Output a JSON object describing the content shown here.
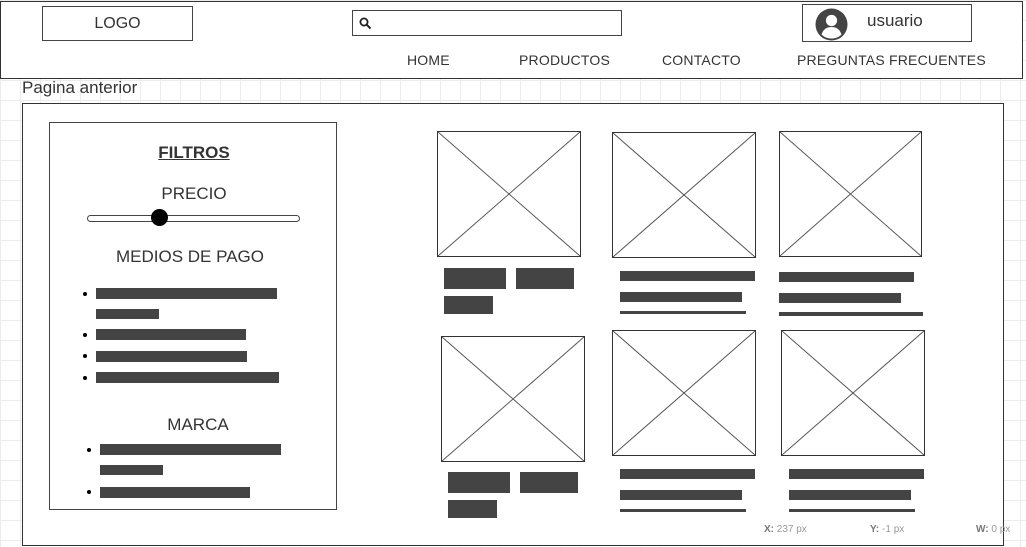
{
  "header": {
    "logo_label": "LOGO",
    "search_placeholder": "",
    "search_icon": "search-icon",
    "user": {
      "avatar_icon": "user-avatar-icon",
      "name": "usuario"
    },
    "nav": [
      "HOME",
      "PRODUCTOS",
      "CONTACTO",
      "PREGUNTAS FRECUENTES"
    ]
  },
  "back_link": "Pagina anterior",
  "filters": {
    "title": "FILTROS",
    "price_label": "PRECIO",
    "price_slider_level": 0.34,
    "payment_label": "MEDIOS DE PAGO",
    "brand_label": "MARCA"
  },
  "products": {
    "placeholder_icon": "image-placeholder-icon",
    "count": 6
  },
  "readout": {
    "x_label": "X:",
    "x_value": "237 px",
    "y_label": "Y:",
    "y_value": "-1 px",
    "w_label": "W:",
    "w_value": "0 px"
  },
  "colors": {
    "stroke": "#333333",
    "bar": "#444444",
    "grid": "#ececec"
  }
}
